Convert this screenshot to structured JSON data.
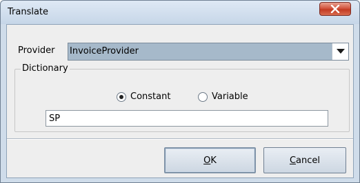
{
  "window": {
    "title": "Translate",
    "close_icon": "close-icon"
  },
  "provider": {
    "label": "Provider",
    "selected": "InvoiceProvider",
    "dropdown_icon": "chevron-down-icon"
  },
  "dictionary": {
    "legend": "Dictionary",
    "options": [
      {
        "label": "Constant",
        "selected": true
      },
      {
        "label": "Variable",
        "selected": false
      }
    ],
    "value": "SP"
  },
  "buttons": {
    "ok": {
      "mnemonic": "O",
      "rest": "K"
    },
    "cancel": {
      "mnemonic": "C",
      "rest": "ancel"
    }
  }
}
